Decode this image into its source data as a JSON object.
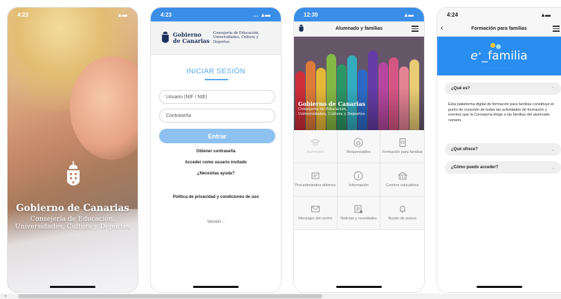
{
  "screens": [
    {
      "time": "4:23",
      "title": "Gobierno de Canarias",
      "subtitle_lines": [
        "Consejería de Educación,",
        "Universidades, Cultura y Deportes"
      ]
    },
    {
      "time": "4:23",
      "header": {
        "org_lines": [
          "Gobierno",
          "de Canarias"
        ],
        "dept_lines": [
          "Consejería de Educación,",
          "Universidades, Cultura y Deportes"
        ]
      },
      "login_title": "INICIAR SESIÓN",
      "username_placeholder": "Usuario (NIF / NIE)",
      "password_placeholder": "Contraseña",
      "enter_label": "Entrar",
      "get_password": "Obtener contraseña",
      "guest_access": "Acceder como usuario invitado",
      "need_help": "¿Necesitas ayuda?",
      "privacy": "Política de privacidad y condiciones de uso",
      "version": "Versión: -"
    },
    {
      "time": "12:39",
      "nav_title": "Alumnado y familias",
      "banner_title": "Gobierno de Canarias",
      "banner_sub_lines": [
        "Consejería de Educación,",
        "Universidades, Cultura y Deportes"
      ],
      "grid": [
        {
          "label": "Alumnado",
          "icon": "graduation-cap-icon"
        },
        {
          "label": "Responsables",
          "icon": "house-icon"
        },
        {
          "label": "Formación para familias",
          "icon": "book-icon"
        },
        {
          "label": "Procedimientos abiertos",
          "icon": "document-icon"
        },
        {
          "label": "Información",
          "icon": "info-icon"
        },
        {
          "label": "Centros educativos",
          "icon": "school-icon"
        },
        {
          "label": "Mensajes del centro",
          "icon": "envelope-icon"
        },
        {
          "label": "Noticias y novedades",
          "icon": "newspaper-icon"
        },
        {
          "label": "Buzón de avisos",
          "icon": "bell-icon"
        }
      ]
    },
    {
      "time": "4:24",
      "nav_title": "Formación para familias",
      "logo_text": "familia",
      "q1": "¿Qué es?",
      "answer": "Esta plataforma digital de formación para familias constituye el punto de conexión de todas las actividades de formación y eventos que la Consejería dirige a las familias del alumnado canario.",
      "q2": "¿Qué ofrece?",
      "q3": "¿Cómo puedo acceder?"
    }
  ],
  "colors": {
    "accent": "#3b8ee8",
    "button": "#8ec1ef",
    "efamilia_blue": "#2a8df0"
  }
}
